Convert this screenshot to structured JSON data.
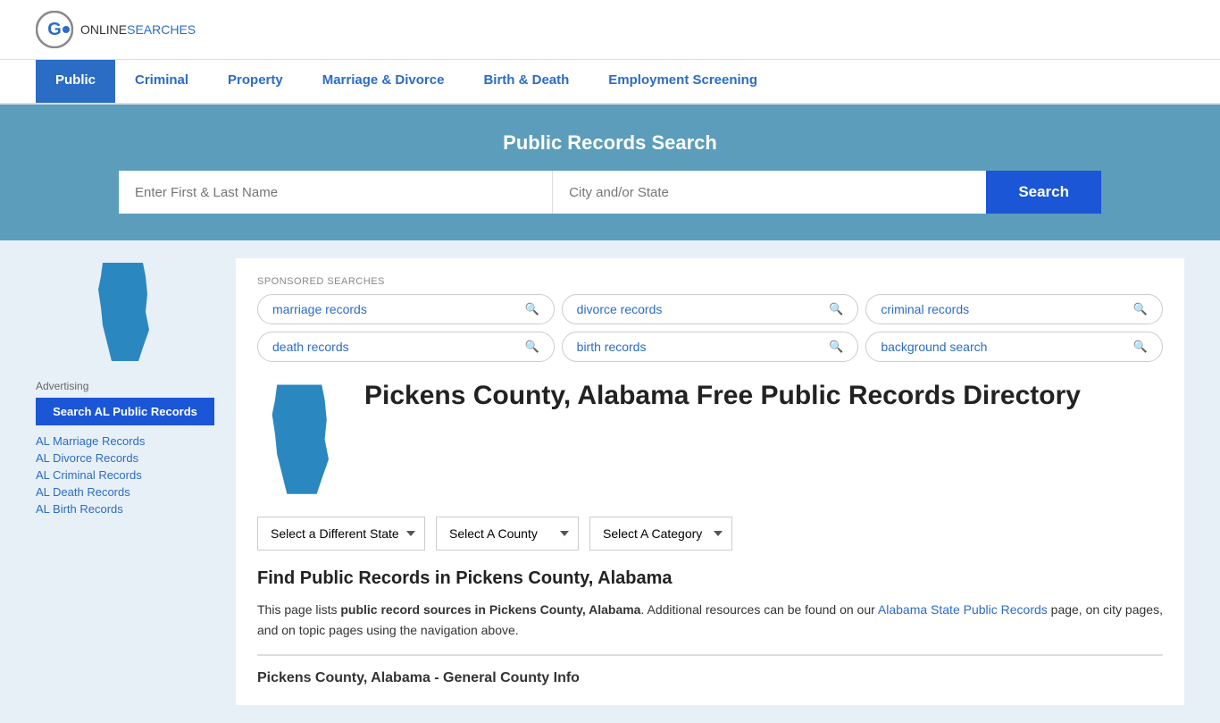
{
  "logo": {
    "icon_label": "online-searches-logo-icon",
    "text_online": "ONLINE",
    "text_searches": "SEARCHES"
  },
  "nav": {
    "items": [
      {
        "label": "Public",
        "active": true
      },
      {
        "label": "Criminal",
        "active": false
      },
      {
        "label": "Property",
        "active": false
      },
      {
        "label": "Marriage & Divorce",
        "active": false
      },
      {
        "label": "Birth & Death",
        "active": false
      },
      {
        "label": "Employment Screening",
        "active": false
      }
    ]
  },
  "search_banner": {
    "title": "Public Records Search",
    "name_placeholder": "Enter First & Last Name",
    "location_placeholder": "City and/or State",
    "button_label": "Search"
  },
  "sponsored": {
    "label": "SPONSORED SEARCHES",
    "pills": [
      {
        "label": "marriage records"
      },
      {
        "label": "divorce records"
      },
      {
        "label": "criminal records"
      },
      {
        "label": "death records"
      },
      {
        "label": "birth records"
      },
      {
        "label": "background search"
      }
    ]
  },
  "page": {
    "title": "Pickens County, Alabama Free Public Records Directory",
    "find_title": "Find Public Records in Pickens County, Alabama",
    "find_desc_1": "This page lists ",
    "find_desc_bold": "public record sources in Pickens County, Alabama",
    "find_desc_2": ". Additional resources can be found on our ",
    "find_desc_link": "Alabama State Public Records",
    "find_desc_3": " page, on city pages, and on topic pages using the navigation above.",
    "general_info_title": "Pickens County, Alabama - General County Info"
  },
  "dropdowns": {
    "state": {
      "label": "Select a Different State",
      "options": [
        "Select a Different State"
      ]
    },
    "county": {
      "label": "Select A County",
      "options": [
        "Select A County"
      ]
    },
    "category": {
      "label": "Select A Category",
      "options": [
        "Select A Category"
      ]
    }
  },
  "sidebar": {
    "advertising_label": "Advertising",
    "search_btn_label": "Search AL Public Records",
    "links": [
      {
        "label": "AL Marriage Records"
      },
      {
        "label": "AL Divorce Records"
      },
      {
        "label": "AL Criminal Records"
      },
      {
        "label": "AL Death Records"
      },
      {
        "label": "AL Birth Records"
      }
    ]
  }
}
